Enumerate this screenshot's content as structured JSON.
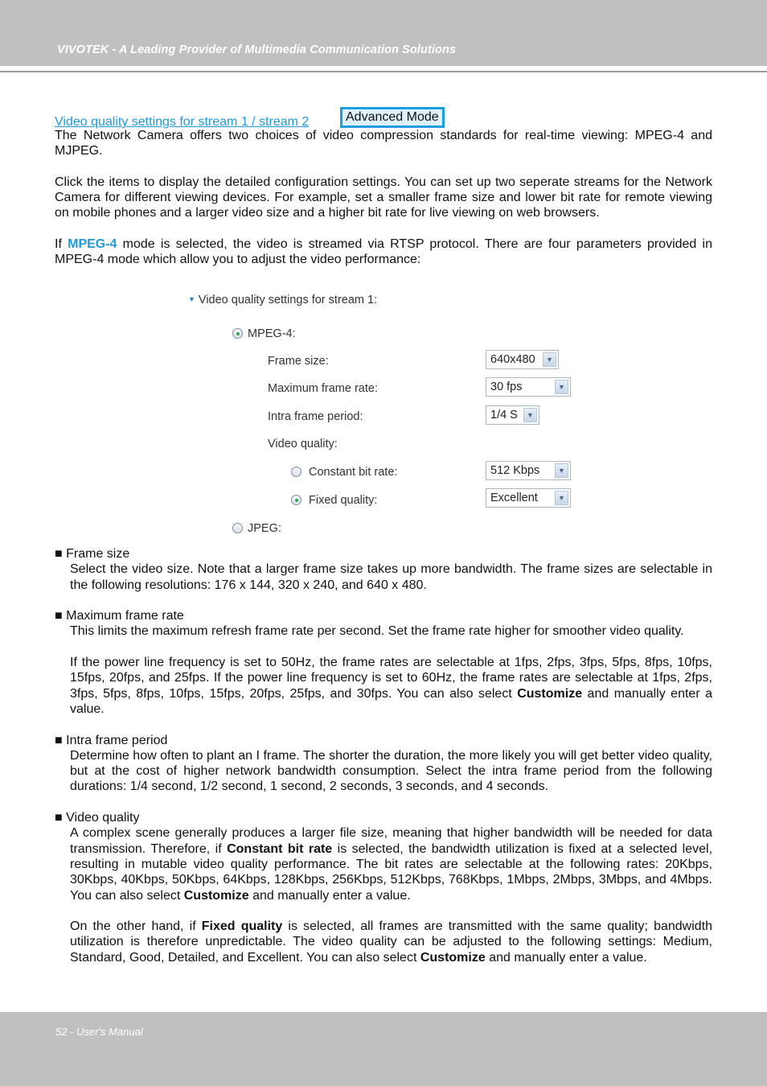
{
  "header": {
    "title": "VIVOTEK - A Leading Provider of Multimedia Communication Solutions"
  },
  "section": {
    "link": "Video quality settings for stream 1 / stream 2",
    "advanced_button": "Advanced Mode",
    "intro": "The Network Camera offers two choices of video compression standards for real-time viewing: MPEG-4 and MJPEG.",
    "para2": "Click the items to display the detailed configuration settings. You can set up two seperate streams for the Network Camera for different viewing devices. For example, set a smaller frame size and lower bit rate for remote viewing on mobile phones and a larger video size and a higher bit rate for live viewing on web browsers.",
    "para3_prefix": "If ",
    "para3_keyword": "MPEG-4",
    "para3_suffix": " mode is selected, the video is streamed via RTSP protocol. There are four parameters provided in MPEG-4 mode which allow you to adjust the video performance:"
  },
  "figure": {
    "title": "Video quality settings for stream 1:",
    "mpeg4_label": "MPEG-4:",
    "frame_size_label": "Frame size:",
    "frame_size_value": "640x480",
    "max_frame_rate_label": "Maximum frame rate:",
    "max_frame_rate_value": "30 fps",
    "intra_frame_label": "Intra frame period:",
    "intra_frame_value": "1/4 S",
    "video_quality_label": "Video quality:",
    "cbr_label": "Constant bit rate:",
    "cbr_value": "512 Kbps",
    "fixed_quality_label": "Fixed quality:",
    "fixed_quality_value": "Excellent",
    "jpeg_label": "JPEG:",
    "mpeg4_selected": true,
    "fixed_quality_selected": true
  },
  "bullets": {
    "frame_size": {
      "title": "Frame size",
      "text": "Select the video size. Note that a larger frame size takes up more bandwidth. The frame sizes are selectable in the following resolutions: 176 x 144, 320 x 240, and 640 x 480."
    },
    "max_frame_rate": {
      "title": "Maximum frame rate",
      "text1": "This limits the maximum refresh frame rate per second. Set the frame rate higher for smoother video quality.",
      "text2": "If the power line frequency is set to 50Hz, the frame rates are selectable at 1fps, 2fps, 3fps, 5fps, 8fps, 10fps, 15fps, 20fps, and 25fps. If the power line frequency is set to 60Hz, the frame rates are selectable at 1fps, 2fps, 3fps, 5fps, 8fps, 10fps, 15fps, 20fps, 25fps, and 30fps. You can also select ",
      "text2_bold": "Customize",
      "text2_end": " and manually enter a value."
    },
    "intra_frame": {
      "title": "Intra frame period",
      "text": "Determine how often to plant an I frame. The shorter the duration, the more likely you will get better video quality, but at the cost of higher network bandwidth consumption. Select the intra frame period from the following durations: 1/4 second, 1/2 second, 1 second, 2 seconds, 3 seconds, and 4 seconds."
    },
    "video_quality": {
      "title": "Video quality",
      "p1_a": "A complex scene generally produces a larger file size, meaning that higher bandwidth will be needed for data transmission. Therefore, if ",
      "p1_b": "Constant bit rate",
      "p1_c": " is selected, the bandwidth utilization is fixed at a selected level, resulting in mutable video quality performance. The bit rates are selectable at the following rates: 20Kbps, 30Kbps, 40Kbps, 50Kbps, 64Kbps, 128Kbps, 256Kbps, 512Kbps, 768Kbps, 1Mbps, 2Mbps, 3Mbps, and 4Mbps. You can also select ",
      "p1_d": "Customize",
      "p1_e": " and manually enter a value.",
      "p2_a": "On the other hand, if ",
      "p2_b": "Fixed quality",
      "p2_c": " is selected, all frames are transmitted with the same quality; bandwidth utilization is therefore unpredictable. The video quality can be adjusted to the following settings: Medium, Standard, Good, Detailed, and Excellent. You can also select ",
      "p2_d": "Customize",
      "p2_e": " and manually enter a value."
    },
    "bullet_glyph": "■"
  },
  "footer": {
    "text": "52 - User's Manual"
  }
}
